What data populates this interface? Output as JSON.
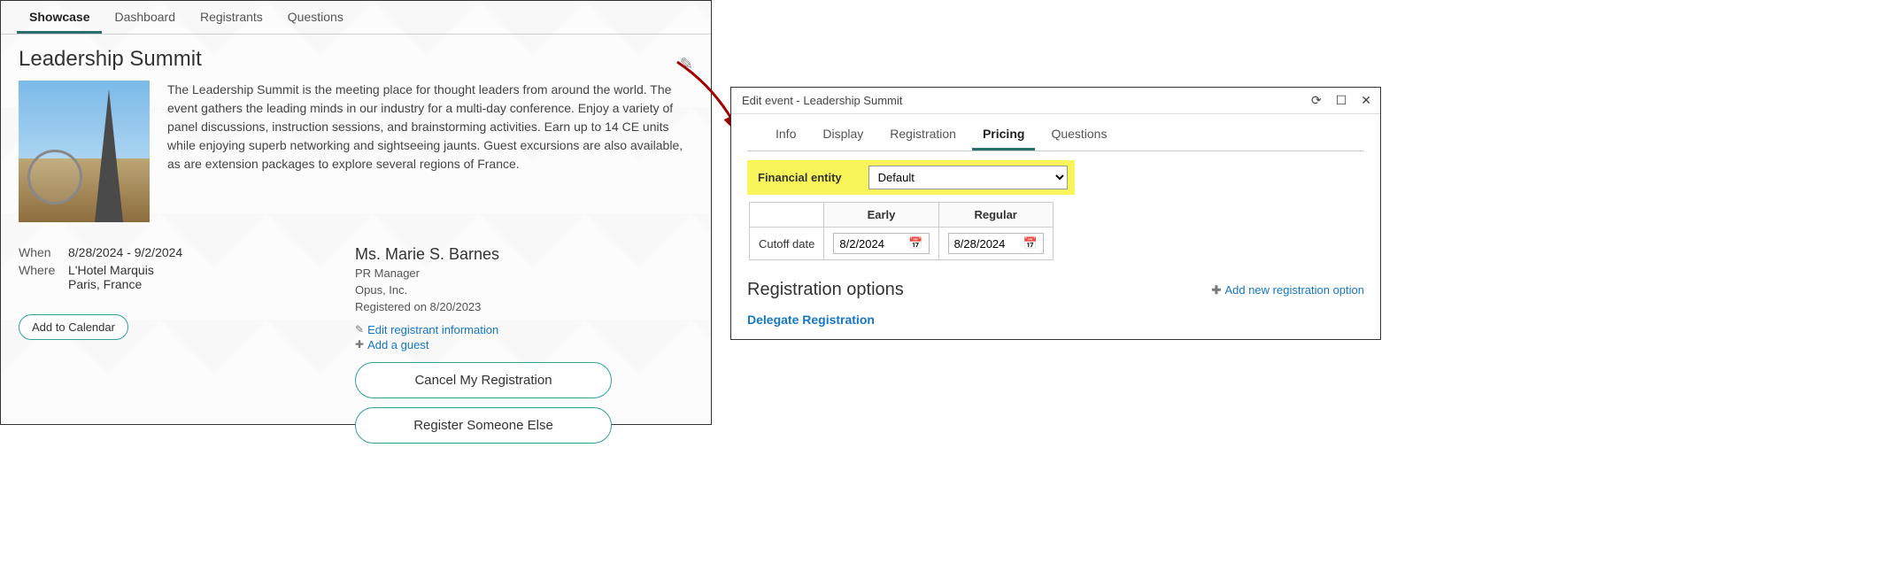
{
  "leftTabs": {
    "showcase": "Showcase",
    "dashboard": "Dashboard",
    "registrants": "Registrants",
    "questions": "Questions"
  },
  "event": {
    "title": "Leadership Summit",
    "description": "The Leadership Summit is the meeting place for thought leaders from around the world. The event gathers the leading minds in our industry for a multi-day conference. Enjoy a variety of panel discussions, instruction sessions, and brainstorming activities. Earn up to 14 CE units while enjoying superb networking and sightseeing jaunts. Guest excursions are also available, as are extension packages to explore several regions of France.",
    "whenLabel": "When",
    "whenValue": "8/28/2024 - 9/2/2024",
    "whereLabel": "Where",
    "whereLine1": "L'Hotel Marquis",
    "whereLine2": "Paris, France",
    "addToCalendar": "Add to Calendar"
  },
  "registrant": {
    "name": "Ms. Marie S. Barnes",
    "title": "PR Manager",
    "org": "Opus, Inc.",
    "registeredOn": "Registered on 8/20/2023",
    "editLink": "Edit registrant information",
    "addGuest": "Add a guest",
    "cancelBtn": "Cancel My Registration",
    "registerOtherBtn": "Register Someone Else"
  },
  "dialog": {
    "title": "Edit event - Leadership Summit",
    "tabs": {
      "info": "Info",
      "display": "Display",
      "registration": "Registration",
      "pricing": "Pricing",
      "questions": "Questions"
    },
    "financial": {
      "label": "Financial entity",
      "value": "Default"
    },
    "cutoff": {
      "rowLabel": "Cutoff date",
      "earlyHeader": "Early",
      "regularHeader": "Regular",
      "earlyDate": "8/2/2024",
      "regularDate": "8/28/2024"
    },
    "regOptions": {
      "heading": "Registration options",
      "addLink": "Add new registration option",
      "delegate": "Delegate Registration"
    }
  }
}
